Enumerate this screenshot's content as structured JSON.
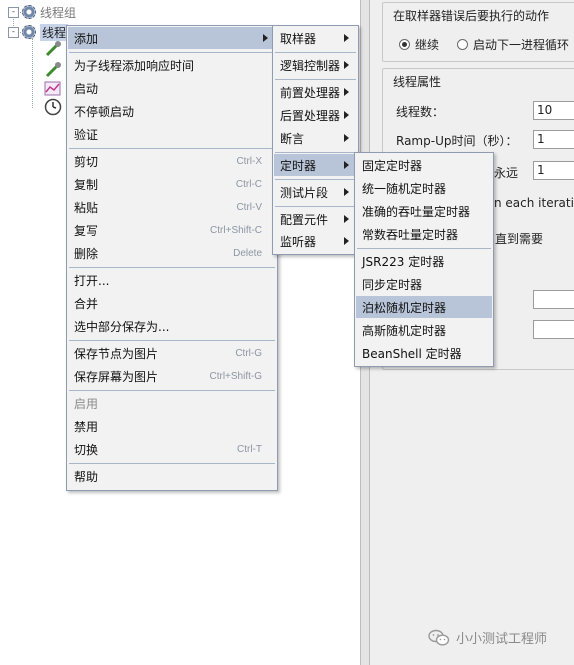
{
  "tree": {
    "thread_group_label": "线程组",
    "selected_label": "线程",
    "node_icons": [
      "gear-icon",
      "gear-icon",
      "sampler-pipette-icon",
      "sampler-pipette-icon",
      "listener-chart-icon",
      "timer-clock-icon"
    ]
  },
  "panel": {
    "error_group_title": "在取样器错误后要执行的动作",
    "radio_continue": "继续",
    "radio_next_loop": "启动下一进程循环",
    "thread_group_title": "线程属性",
    "threads_label": "线程数：",
    "threads_value": "10",
    "rampup_label": "Ramp-Up时间（秒）：",
    "rampup_value": "1",
    "forever_label": "永远",
    "loop_value": "1",
    "each_iteration_text": "n each iteration",
    "until_needed_text": "直到需要"
  },
  "context_menu": {
    "items": [
      {
        "label": "添加",
        "shortcut": "",
        "submenu": true
      },
      {
        "label": "为子线程添加响应时间",
        "shortcut": ""
      },
      {
        "label": "启动",
        "shortcut": ""
      },
      {
        "label": "不停顿启动",
        "shortcut": ""
      },
      {
        "label": "验证",
        "shortcut": ""
      },
      {
        "label": "剪切",
        "shortcut": "Ctrl-X"
      },
      {
        "label": "复制",
        "shortcut": "Ctrl-C"
      },
      {
        "label": "粘贴",
        "shortcut": "Ctrl-V"
      },
      {
        "label": "复写",
        "shortcut": "Ctrl+Shift-C"
      },
      {
        "label": "删除",
        "shortcut": "Delete"
      },
      {
        "label": "打开...",
        "shortcut": ""
      },
      {
        "label": "合并",
        "shortcut": ""
      },
      {
        "label": "选中部分保存为...",
        "shortcut": ""
      },
      {
        "label": "保存节点为图片",
        "shortcut": "Ctrl-G"
      },
      {
        "label": "保存屏幕为图片",
        "shortcut": "Ctrl+Shift-G"
      },
      {
        "label": "启用",
        "shortcut": "",
        "disabled": true
      },
      {
        "label": "禁用",
        "shortcut": ""
      },
      {
        "label": "切换",
        "shortcut": "Ctrl-T"
      },
      {
        "label": "帮助",
        "shortcut": ""
      }
    ]
  },
  "add_menu": {
    "items": [
      {
        "label": "取样器"
      },
      {
        "label": "逻辑控制器"
      },
      {
        "label": "前置处理器"
      },
      {
        "label": "后置处理器"
      },
      {
        "label": "断言"
      },
      {
        "label": "定时器"
      },
      {
        "label": "测试片段"
      },
      {
        "label": "配置元件"
      },
      {
        "label": "监听器"
      }
    ]
  },
  "timer_menu": {
    "items": [
      {
        "label": "固定定时器"
      },
      {
        "label": "统一随机定时器"
      },
      {
        "label": "准确的吞吐量定时器"
      },
      {
        "label": "常数吞吐量定时器"
      },
      {
        "label": "JSR223 定时器"
      },
      {
        "label": "同步定时器"
      },
      {
        "label": "泊松随机定时器"
      },
      {
        "label": "高斯随机定时器"
      },
      {
        "label": "BeanShell 定时器"
      }
    ]
  },
  "watermark": {
    "text": "小小测试工程师"
  },
  "colors": {
    "highlight": "#b8c5d8",
    "menu_bg": "#f2f2f2",
    "menu_border": "#8e9bb0"
  }
}
